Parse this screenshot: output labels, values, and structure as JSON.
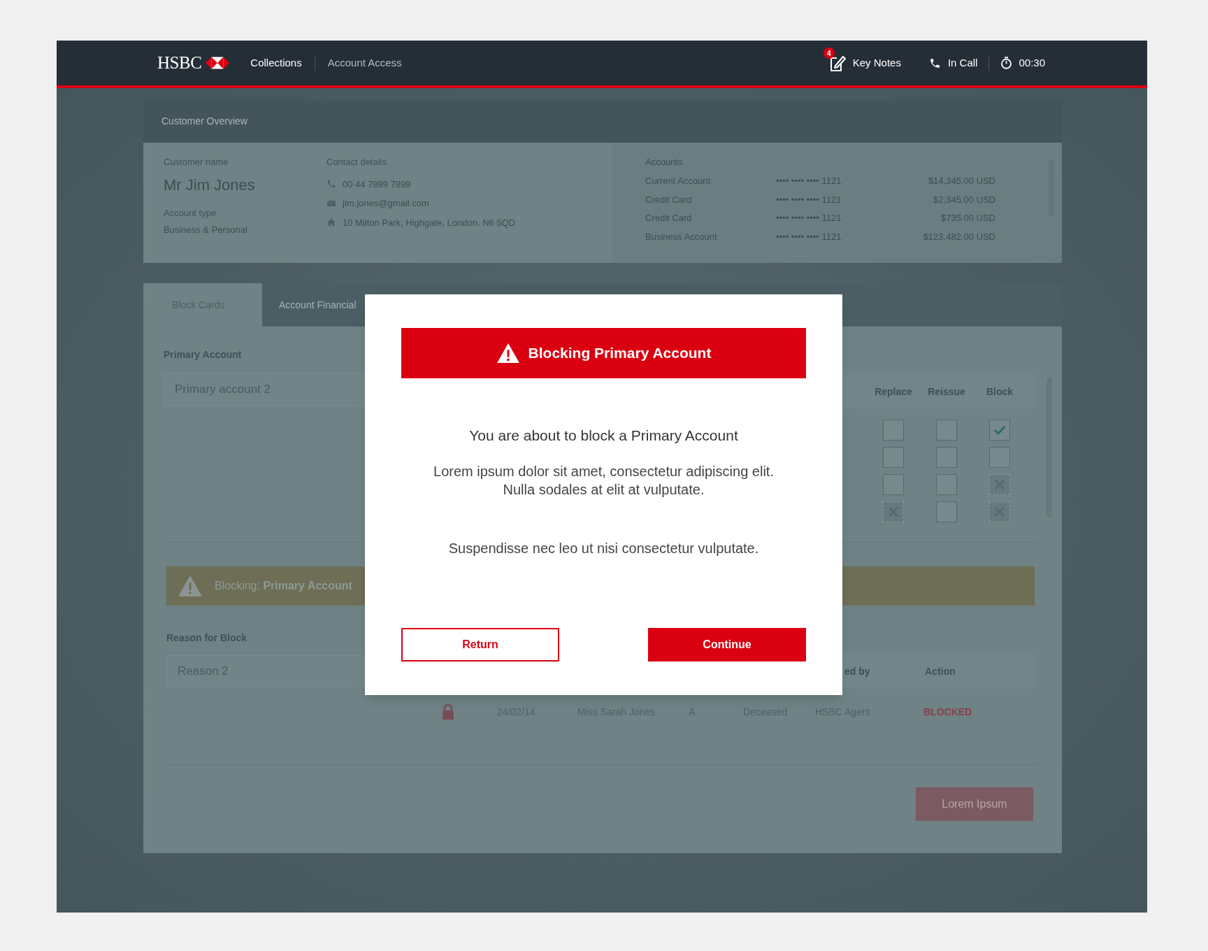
{
  "header": {
    "logo": "HSBC",
    "nav": [
      {
        "label": "Collections",
        "selected": true
      },
      {
        "label": "Account Access",
        "selected": false
      }
    ],
    "notes_badge": "4",
    "key_notes": "Key Notes",
    "call_status": "In Call",
    "timer": "00:30"
  },
  "customer_overview": {
    "title": "Customer Overview",
    "customer_name_label": "Customer name",
    "customer_name": "Mr Jim Jones",
    "account_type_label": "Account type",
    "account_type": "Business & Personal",
    "contact_label": "Contact details",
    "contacts": [
      {
        "kind": "phone",
        "text": "00 44 7899 7899"
      },
      {
        "kind": "email",
        "text": "jim.jones@gmail.com"
      },
      {
        "kind": "address",
        "text": "10 Milton Park, Highgate, London. N6 5QD"
      }
    ],
    "accounts_label": "Accounts",
    "accounts": [
      {
        "name": "Current Account",
        "number": "•••• •••• •••• 1121",
        "balance": "$14,345.00 USD"
      },
      {
        "name": "Credit Card",
        "number": "•••• •••• •••• 1121",
        "balance": "$2,345.00 USD"
      },
      {
        "name": "Credit Card",
        "number": "•••• •••• •••• 1121",
        "balance": "$735.00 USD"
      },
      {
        "name": "Business Account",
        "number": "•••• •••• •••• 1121",
        "balance": "$123,482.00 USD"
      }
    ]
  },
  "tabs": [
    {
      "label": "Block Cards",
      "selected": true
    },
    {
      "label": "Account Financial",
      "selected": false
    }
  ],
  "block_cards": {
    "primary_account_label": "Primary Account",
    "primary_account": "Primary account 2",
    "card_columns": [
      "Replace",
      "Reissue",
      "Block"
    ],
    "card_rows": [
      [
        {
          "checked": false,
          "disabled": false
        },
        {
          "checked": false,
          "disabled": false
        },
        {
          "checked": true,
          "disabled": false
        }
      ],
      [
        {
          "checked": false,
          "disabled": false
        },
        {
          "checked": false,
          "disabled": false
        },
        {
          "checked": false,
          "disabled": false
        }
      ],
      [
        {
          "checked": false,
          "disabled": false
        },
        {
          "checked": false,
          "disabled": false
        },
        {
          "checked": false,
          "disabled": true
        }
      ],
      [
        {
          "checked": false,
          "disabled": true
        },
        {
          "checked": false,
          "disabled": false
        },
        {
          "checked": false,
          "disabled": true
        }
      ]
    ],
    "warning": "Blocking: **Primary Account**",
    "reason_label": "Reason for Block",
    "reason": "Reason 2",
    "history_columns": [
      "ed by",
      "Action"
    ],
    "history_rows": [
      {
        "cells": [
          "24/02/14",
          "Miss Sarah Jones",
          "A",
          "Deceased",
          "HSBC Agent"
        ],
        "action": "BLOCKED"
      }
    ],
    "submit": "Lorem Ipsum"
  },
  "modal": {
    "title": "Blocking Primary Account",
    "heading": "You are about to block a Primary Account",
    "body": "Lorem ipsum dolor sit amet, consectetur adipiscing elit.\nNulla sodales at elit at vulputate.",
    "note": "Suspendisse nec leo ut nisi consectetur vulputate.",
    "buttons": [
      {
        "kind": "secondary",
        "label": "Return"
      },
      {
        "kind": "primary",
        "label": "Continue"
      }
    ]
  }
}
